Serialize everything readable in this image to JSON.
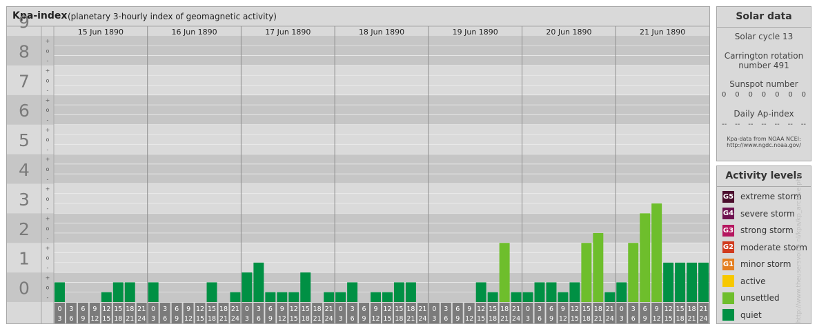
{
  "header": {
    "title": "Kpa-index",
    "subtitle": "(planetary 3-hourly index of geomagnetic activity)"
  },
  "chart_data": {
    "type": "bar",
    "title": "Kpa-index",
    "subtitle": "(planetary 3-hourly index of geomagnetic activity)",
    "ylim": [
      0,
      9
    ],
    "y_ticks": [
      "0",
      "1",
      "2",
      "3",
      "4",
      "5",
      "6",
      "7",
      "8",
      "9"
    ],
    "sub_ticks": [
      "-",
      "o",
      "+"
    ],
    "days": [
      "15 Jun 1890",
      "16 Jun 1890",
      "17 Jun 1890",
      "18 Jun 1890",
      "19 Jun 1890",
      "20 Jun 1890",
      "21 Jun 1890"
    ],
    "interval_start": [
      "0",
      "3",
      "6",
      "9",
      "12",
      "15",
      "18",
      "21"
    ],
    "interval_end": [
      "3",
      "6",
      "9",
      "12",
      "15",
      "18",
      "21",
      "24"
    ],
    "values": [
      [
        0.667,
        0,
        0,
        0,
        0.333,
        0.667,
        0.667,
        0
      ],
      [
        0.667,
        0,
        0,
        0,
        0,
        0.667,
        0,
        0.333
      ],
      [
        1.0,
        1.333,
        0.333,
        0.333,
        0.333,
        1.0,
        0,
        0.333
      ],
      [
        0.333,
        0.667,
        0,
        0.333,
        0.333,
        0.667,
        0.667,
        0
      ],
      [
        0,
        0,
        0,
        0,
        0.667,
        0.333,
        2.0,
        0.333
      ],
      [
        0.333,
        0.667,
        0.667,
        0.333,
        0.667,
        2.0,
        2.333,
        0.333
      ],
      [
        0.667,
        2.0,
        3.0,
        3.333,
        1.333,
        1.333,
        1.333,
        1.333
      ]
    ],
    "grid": true,
    "colors": {
      "quiet": "#009044",
      "unsettled": "#6ebe2c",
      "band_dark": "#c6c6c6",
      "band_light": "#dadada",
      "axis_number": "#7a7a7a",
      "hour_box": "#7b7b7b"
    }
  },
  "solar": {
    "title": "Solar data",
    "cycle": "Solar cycle 13",
    "carrington_line1": "Carrington rotation",
    "carrington_line2": "number 491",
    "sunspot_label": "Sunspot number",
    "sunspot_values": [
      "0",
      "0",
      "0",
      "0",
      "0",
      "0",
      "0"
    ],
    "ap_label": "Daily Ap-index",
    "ap_values": [
      "--",
      "--",
      "--",
      "--",
      "--",
      "--",
      "--"
    ],
    "source_line1": "Kpa-data from NOAA NCEI:",
    "source_line2": "http://www.ngdc.noaa.gov/"
  },
  "activity": {
    "title": "Activity levels",
    "items": [
      {
        "badge": "G5",
        "label": "extreme storm",
        "color": "#4a0d2c"
      },
      {
        "badge": "G4",
        "label": "severe storm",
        "color": "#6e1150"
      },
      {
        "badge": "G3",
        "label": "strong storm",
        "color": "#b5165f"
      },
      {
        "badge": "G2",
        "label": "moderate storm",
        "color": "#d13b1e"
      },
      {
        "badge": "G1",
        "label": "minor storm",
        "color": "#e47f20"
      },
      {
        "badge": "",
        "label": "active",
        "color": "#f7c800"
      },
      {
        "badge": "",
        "label": "unsettled",
        "color": "#6ebe2c"
      },
      {
        "badge": "",
        "label": "quiet",
        "color": "#009044"
      }
    ]
  },
  "watermark": "http://www.theusersvoice.nl/kpa/kp_archive.php"
}
